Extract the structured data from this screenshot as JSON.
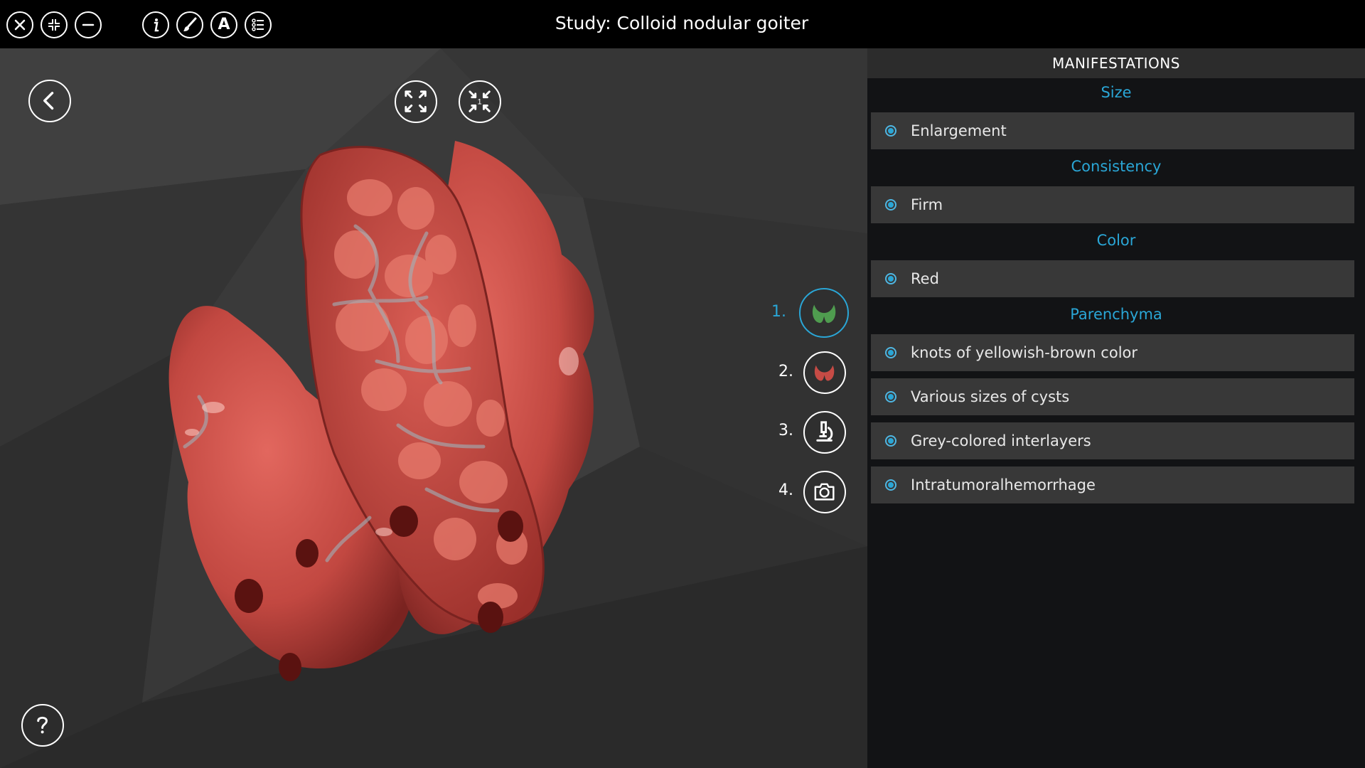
{
  "window": {
    "title": "Study: Colloid nodular goiter"
  },
  "toolbar": {
    "icons": [
      "close-icon",
      "shrink-icon",
      "minimize-icon",
      "info-icon",
      "brush-icon",
      "annotation-icon",
      "list-icon"
    ],
    "annotation_letter": "A"
  },
  "viewport": {
    "views": [
      {
        "number": "1.",
        "icon": "thyroid-green-icon",
        "active": true
      },
      {
        "number": "2.",
        "icon": "thyroid-red-icon",
        "active": false
      },
      {
        "number": "3.",
        "icon": "microscope-icon",
        "active": false
      },
      {
        "number": "4.",
        "icon": "camera-icon",
        "active": false
      }
    ],
    "reset_view_badge": "1"
  },
  "panel": {
    "header": "MANIFESTATIONS",
    "sections": [
      {
        "title": "Size",
        "items": [
          "Enlargement"
        ]
      },
      {
        "title": "Consistency",
        "items": [
          "Firm"
        ]
      },
      {
        "title": "Color",
        "items": [
          "Red"
        ]
      },
      {
        "title": "Parenchyma",
        "items": [
          "knots of yellowish-brown color",
          "Various sizes of cysts",
          "Grey-colored interlayers",
          "Intratumoralhemorrhage"
        ]
      }
    ]
  },
  "colors": {
    "accent": "#2aa6d6",
    "panel_bg": "#121315",
    "item_bg": "#383838",
    "specimen": "#c9504a"
  }
}
